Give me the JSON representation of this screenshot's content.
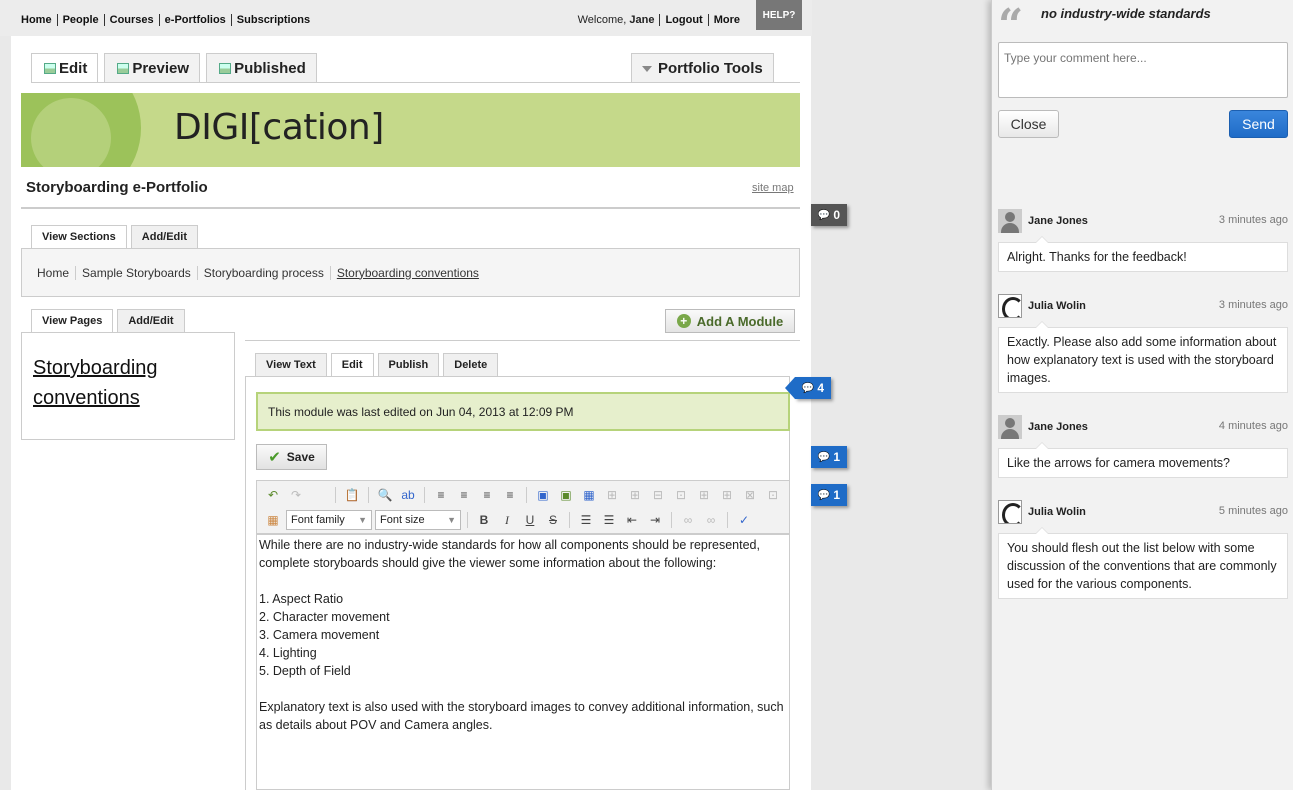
{
  "topnav": {
    "links": [
      "Home",
      "People",
      "Courses",
      "e-Portfolios",
      "Subscriptions"
    ],
    "welcome_prefix": "Welcome,",
    "user": "Jane",
    "logout": "Logout",
    "more": "More",
    "help": "HELP?"
  },
  "main_tabs": {
    "edit": "Edit",
    "preview": "Preview",
    "published": "Published",
    "portfolio_tools": "Portfolio Tools"
  },
  "banner": {
    "text": "DIGI[cation]",
    "color": "#c5d98a"
  },
  "portfolio_title": "Storyboarding e-Portfolio",
  "site_map": "site map",
  "section_tabs": {
    "view": "View Sections",
    "add": "Add/Edit"
  },
  "breadcrumb": [
    "Home",
    "Sample Storyboards",
    "Storyboarding process",
    "Storyboarding conventions"
  ],
  "page_tabs": {
    "view": "View Pages",
    "add": "Add/Edit"
  },
  "current_page": {
    "line1": "Storyboarding",
    "line2": "conventions"
  },
  "add_module": "Add A Module",
  "module_tabs": {
    "view_text": "View Text",
    "edit": "Edit",
    "publish": "Publish",
    "delete": "Delete"
  },
  "notice": "This module was last edited on Jun 04, 2013 at 12:09 PM",
  "save": "Save",
  "toolbar": {
    "font_family": "Font family",
    "font_size": "Font size"
  },
  "editor_text": "While there are no industry-wide standards for how all components should be represented, complete storyboards should give the viewer some information about the following:\n\n1. Aspect Ratio\n2. Character movement\n3. Camera movement\n4. Lighting\n5. Depth of Field\n\nExplanatory text is also used with the storyboard images to convey additional information, such as details about POV and Camera angles.",
  "markers": {
    "m0": "0",
    "m4": "4",
    "m1a": "1",
    "m1b": "1"
  },
  "colors": {
    "accent_blue": "#1f6cc7",
    "notice_bg": "#e6efcc"
  },
  "comment_panel": {
    "title": "no industry-wide standards",
    "placeholder": "Type your comment here...",
    "close": "Close",
    "send": "Send",
    "comments": [
      {
        "name": "Jane Jones",
        "time": "3 minutes ago",
        "text": "Alright. Thanks for the feedback!"
      },
      {
        "name": "Julia Wolin",
        "time": "3 minutes ago",
        "text": "Exactly. Please also add some information about how explanatory text is used with the storyboard images."
      },
      {
        "name": "Jane Jones",
        "time": "4 minutes ago",
        "text": "Like the arrows for camera movements?"
      },
      {
        "name": "Julia Wolin",
        "time": "5 minutes ago",
        "text": "You should flesh out the list below with some discussion of the conventions that are commonly used for the various components."
      }
    ]
  }
}
